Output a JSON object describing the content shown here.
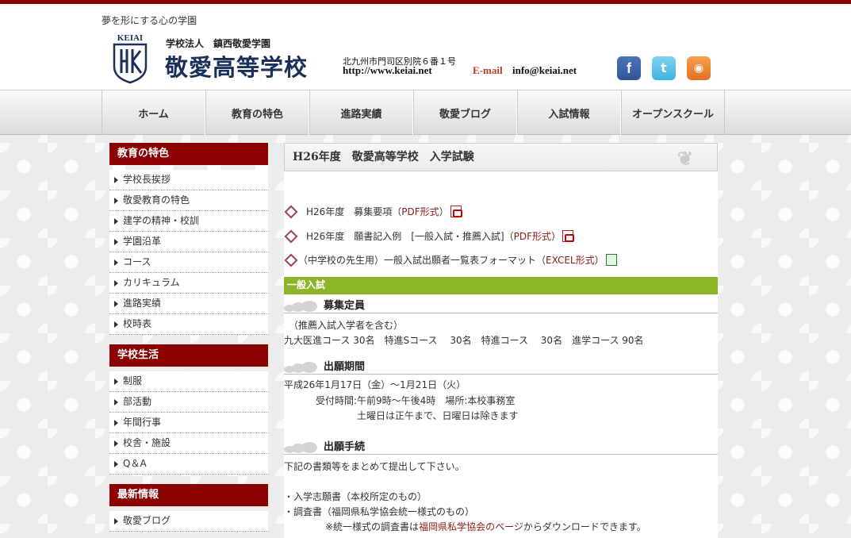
{
  "header": {
    "tagline": "夢を形にする心の学園",
    "logo_small": "学校法人　鎮西敬愛学園",
    "logo_big": "敬愛高等学校",
    "logo_mark_text": "KEIAI",
    "address": "北九州市門司区別院６番１号",
    "url": "http://www.keiai.net",
    "email_label": "E-mail",
    "email_value": "info@keiai.net"
  },
  "social": {
    "facebook_glyph": "f",
    "twitter_glyph": "t",
    "rss_glyph": "◉"
  },
  "nav": [
    "ホーム",
    "教育の特色",
    "進路実績",
    "敬愛ブログ",
    "入試情報",
    "オープンスクール"
  ],
  "sidebar": {
    "sections": [
      {
        "title": "教育の特色",
        "items": [
          "学校長挨拶",
          "敬愛教育の特色",
          "建学の精神・校訓",
          "学園沿革",
          "コース",
          "カリキュラム",
          "進路実績",
          "校時表"
        ]
      },
      {
        "title": "学校生活",
        "items": [
          "制服",
          "部活動",
          "年間行事",
          "校舎・施設",
          "Q＆A"
        ]
      },
      {
        "title": "最新情報",
        "items": [
          "敬愛ブログ"
        ]
      }
    ]
  },
  "main": {
    "title": "H26年度　敬愛高等学校　入学試験",
    "docs": [
      {
        "text": "H26年度　募集要項（",
        "link": "PDF形式",
        "suffix": "）",
        "icon": "pdf"
      },
      {
        "text": "H26年度　願書記入例　[一般入試・推薦入試]（",
        "link": "PDF形式",
        "suffix": "）",
        "icon": "pdf"
      },
      {
        "text": "（中学校の先生用）一般入試出願者一覧表フォーマット（",
        "link": "EXCEL形式",
        "suffix": "）",
        "icon": "xls"
      }
    ],
    "section_bar": "一般入試",
    "recruit": {
      "title": "募集定員",
      "note": "（推薦入試入学者を含む）",
      "courses": "九大医進コース 30名　特進Sコース　 30名　特進コース　 30名　進学コース 90名"
    },
    "period": {
      "title": "出願期間",
      "dates": "平成26年1月17日（金）〜1月21日（火）",
      "hours": "受付時間:午前9時〜午後4時　場所:本校事務室",
      "note": "土曜日は正午まで、日曜日は除きます"
    },
    "procedure": {
      "title": "出願手続",
      "intro": "下記の書類等をまとめて提出して下さい。",
      "item1": "・入学志願書（本校所定のもの）",
      "item2": "・調査書（福岡県私学協会統一様式のもの）",
      "note_pre": "※統一様式の調査書は",
      "note_link": "福岡県私学協会のページ",
      "note_post": "からダウンロードできます。"
    }
  }
}
